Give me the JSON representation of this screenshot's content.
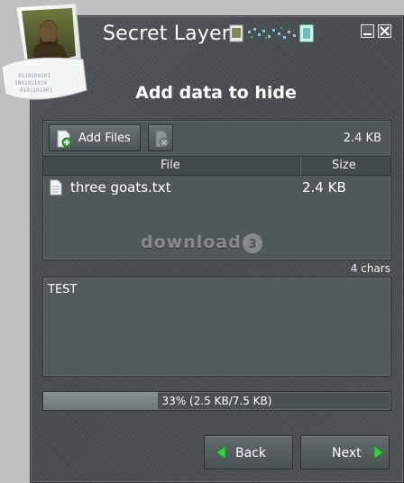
{
  "window": {
    "title": "Secret Layer",
    "heading": "Add data to hide"
  },
  "toolbar": {
    "add_files_label": "Add Files",
    "total_size": "2.4 KB"
  },
  "file_list": {
    "columns": [
      "File",
      "Size"
    ],
    "rows": [
      {
        "name": "three goats.txt",
        "size": "2.4 KB"
      }
    ]
  },
  "watermark": "download",
  "message": {
    "char_count": "4 chars",
    "text": "TEST"
  },
  "progress": {
    "value": 0.33,
    "text": "33% (2.5 KB/7.5 KB)"
  },
  "nav": {
    "back_label": "Back",
    "next_label": "Next"
  },
  "icons": {
    "add": "add-file-icon",
    "remove": "remove-file-icon",
    "file": "text-file-icon",
    "back": "arrow-left-icon",
    "next": "arrow-right-icon"
  },
  "colors": {
    "accent_green": "#2fd53a",
    "window_bg": "#4c5253"
  }
}
